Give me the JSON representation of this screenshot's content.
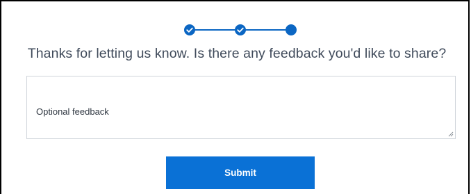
{
  "stepper": {
    "steps": [
      {
        "state": "complete",
        "icon": "check-icon"
      },
      {
        "state": "complete",
        "icon": "check-icon"
      },
      {
        "state": "current",
        "icon": "dot-icon"
      }
    ],
    "color": "#0b66c3"
  },
  "question": "Thanks for letting us know. Is there any feedback you'd like to share?",
  "feedback": {
    "placeholder": "Optional feedback",
    "value": ""
  },
  "submit": {
    "label": "Submit",
    "color": "#0a71d6"
  }
}
